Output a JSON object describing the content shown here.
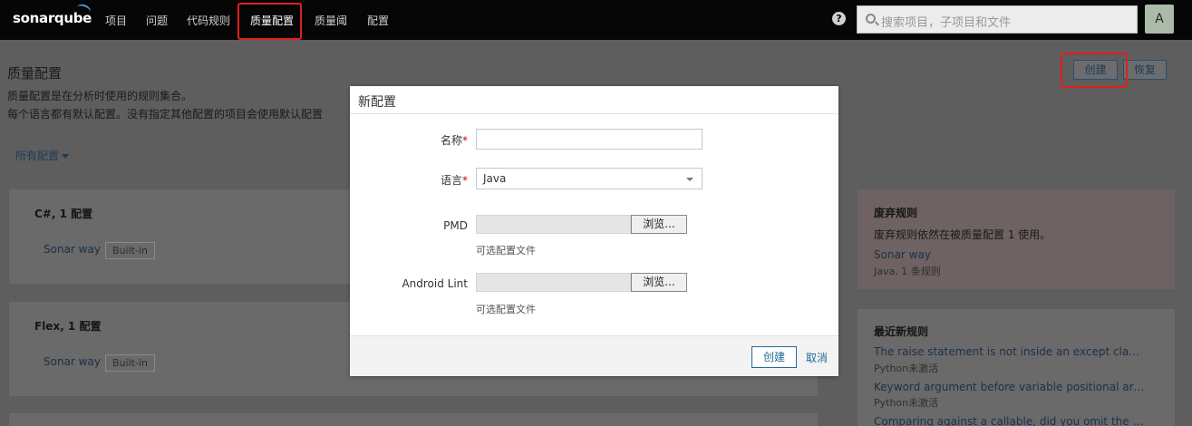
{
  "topbar": {
    "logo": "sonarqube",
    "nav": [
      "项目",
      "问题",
      "代码规则",
      "质量配置",
      "质量阈",
      "配置"
    ],
    "help": "?",
    "search_placeholder": "搜索项目，子项目和文件",
    "avatar": "A"
  },
  "page": {
    "title": "质量配置",
    "desc1": "质量配置是在分析时使用的规则集合。",
    "desc2": "每个语言都有默认配置。没有指定其他配置的项目会使用默认配置",
    "filter": "所有配置",
    "create_label": "创建",
    "restore_label": "恢复"
  },
  "languages": [
    {
      "title": "C#, 1 配置",
      "profile": "Sonar way",
      "badge": "Built-in"
    },
    {
      "title": "Flex, 1 配置",
      "profile": "Sonar way",
      "badge": "Built-in"
    }
  ],
  "deprecated": {
    "title": "废弃规则",
    "text": "废弃规则依然在被质量配置 1 使用。",
    "link": "Sonar way",
    "sub": "Java, 1 条规则"
  },
  "recent": {
    "title": "最近新规则",
    "items": [
      {
        "name": "The raise statement is not inside an except clause",
        "status": "Python未激活"
      },
      {
        "name": "Keyword argument before variable positional argu...",
        "status": "Python未激活"
      },
      {
        "name": "Comparing against a callable, did you omit the par...",
        "status": ""
      }
    ]
  },
  "modal": {
    "title": "新配置",
    "name_label": "名称",
    "lang_label": "语言",
    "required": "*",
    "lang_value": "Java",
    "pmd_label": "PMD",
    "android_label": "Android Lint",
    "browse": "浏览...",
    "hint": "可选配置文件",
    "create": "创建",
    "cancel": "取消"
  }
}
